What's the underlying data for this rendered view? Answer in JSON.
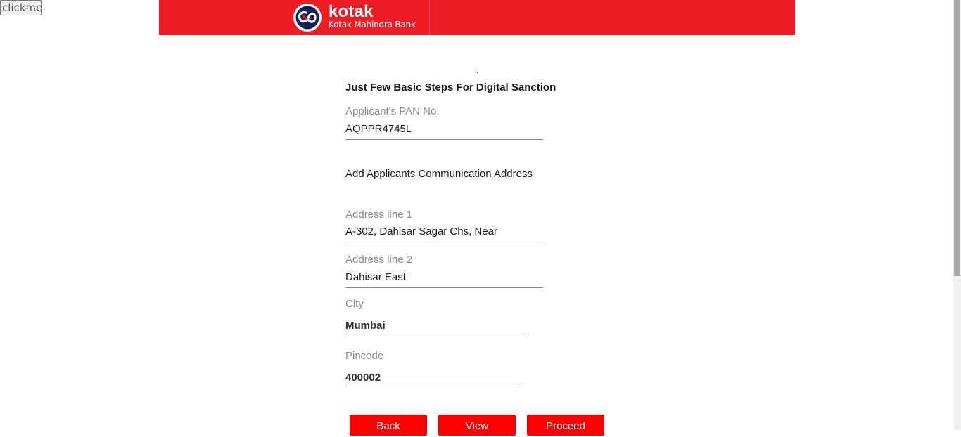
{
  "debug": {
    "clickme_label": "clickme"
  },
  "header": {
    "brand_name": "kotak",
    "brand_subtitle": "Kotak Mahindra Bank",
    "brand_color": "#ed1c24",
    "logo_icon": "kotak-infinity-logo"
  },
  "form": {
    "dot": ".",
    "heading": "Just Few Basic Steps For Digital Sanction",
    "pan": {
      "label": "Applicant's PAN No.",
      "value": "AQPPR4745L"
    },
    "address_heading": "Add Applicants Communication Address",
    "address_line1": {
      "label": "Address line 1",
      "value": "A-302, Dahisar Sagar Chs, Near"
    },
    "address_line2": {
      "label": "Address line 2",
      "value": "Dahisar East"
    },
    "city": {
      "label": "City",
      "value": "Mumbai"
    },
    "pincode": {
      "label": "Pincode",
      "value": "400002"
    }
  },
  "actions": {
    "back_label": "Back",
    "view_label": "View",
    "proceed_label": "Proceed",
    "button_color": "#ff0000"
  }
}
